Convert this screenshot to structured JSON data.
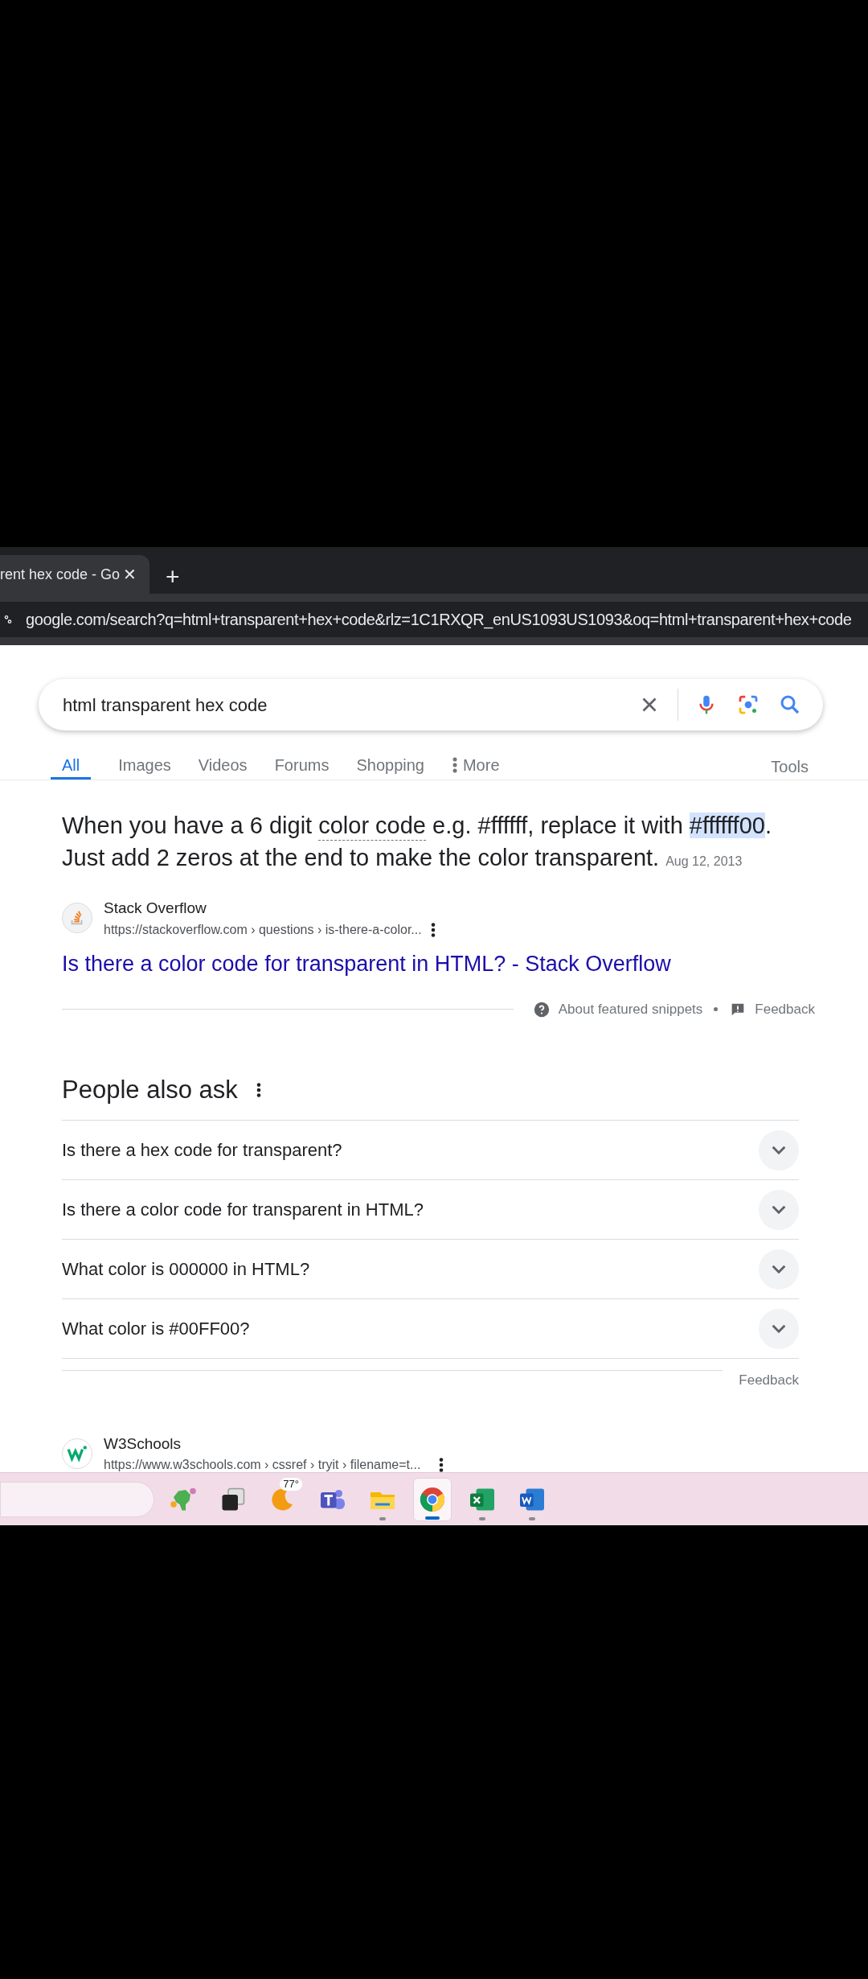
{
  "browser": {
    "tab": {
      "title": "rent hex code - Go",
      "close": "✕"
    },
    "new_tab": "+",
    "url": "google.com/search?q=html+transparent+hex+code&rlz=1C1RXQR_enUS1093US1093&oq=html+transparent+hex+code"
  },
  "search": {
    "value": "html transparent hex code"
  },
  "tabs": [
    {
      "label": "All",
      "selected": true
    },
    {
      "label": "Images",
      "selected": false
    },
    {
      "label": "Videos",
      "selected": false
    },
    {
      "label": "Forums",
      "selected": false
    },
    {
      "label": "Shopping",
      "selected": false
    },
    {
      "label": "More",
      "selected": false,
      "kind": "menu"
    }
  ],
  "tools": "Tools",
  "featured_snippet": {
    "segments": [
      {
        "kind": "plain",
        "text": "When you have a 6 digit "
      },
      {
        "kind": "underlined",
        "text": "color code"
      },
      {
        "kind": "plain",
        "text": " e.g. #ffffff, replace it with "
      },
      {
        "kind": "highlighted",
        "text": "#ffffff00"
      },
      {
        "kind": "plain",
        "text": ". Just add 2 zeros at the end to make the color transparent."
      }
    ],
    "date": "Aug 12, 2013",
    "source": "Stack Overflow",
    "url": "https://stackoverflow.com › questions › is-there-a-color...",
    "title": "Is there a color code for transparent in HTML? - Stack Overflow",
    "about": "About featured snippets",
    "feedback": "Feedback"
  },
  "people_also_ask": {
    "title": "People also ask",
    "questions": [
      {
        "text": "Is there a hex code for transparent?",
        "expanded": false
      },
      {
        "text": "Is there a color code for transparent in HTML?",
        "expanded": false
      },
      {
        "text": "What color is 000000 in HTML?",
        "expanded": false
      },
      {
        "text": "What color is #00FF00?",
        "expanded": false
      }
    ],
    "feedback": "Feedback"
  },
  "result": {
    "source": "W3Schools",
    "url": "https://www.w3schools.com › cssref › tryit › filename=t..."
  },
  "taskbar": {
    "items": [
      {
        "kind": "widgets",
        "running": false,
        "selected": false
      },
      {
        "kind": "taskview",
        "running": false,
        "selected": false
      },
      {
        "kind": "weather",
        "label": "77°",
        "running": false,
        "selected": false
      },
      {
        "kind": "teams",
        "running": false,
        "selected": false
      },
      {
        "kind": "explorer",
        "running": true,
        "selected": false
      },
      {
        "kind": "chrome",
        "running": true,
        "selected": true
      },
      {
        "kind": "excel",
        "running": true,
        "selected": false
      },
      {
        "kind": "word",
        "running": true,
        "selected": false
      }
    ]
  }
}
